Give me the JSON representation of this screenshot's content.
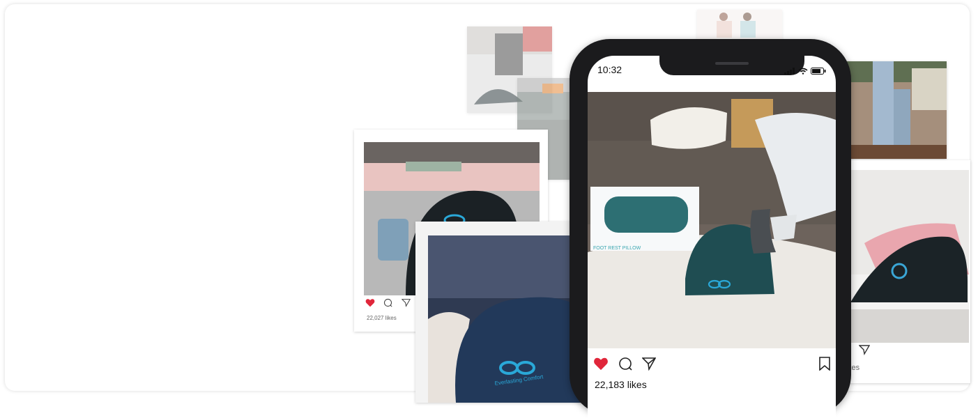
{
  "phone": {
    "time": "10:32",
    "likes": "22,183 likes"
  },
  "left_card": {
    "likes": "22,027 likes",
    "logo_text": ""
  },
  "right_card": {
    "likes_partial": "kes"
  },
  "colors": {
    "heart": "#e0263a",
    "product_teal": "#1f4d52",
    "logo_blue": "#2aa8d8"
  },
  "product_label": "Everlasting Comfort",
  "box_label": "FOOT REST PILLOW"
}
